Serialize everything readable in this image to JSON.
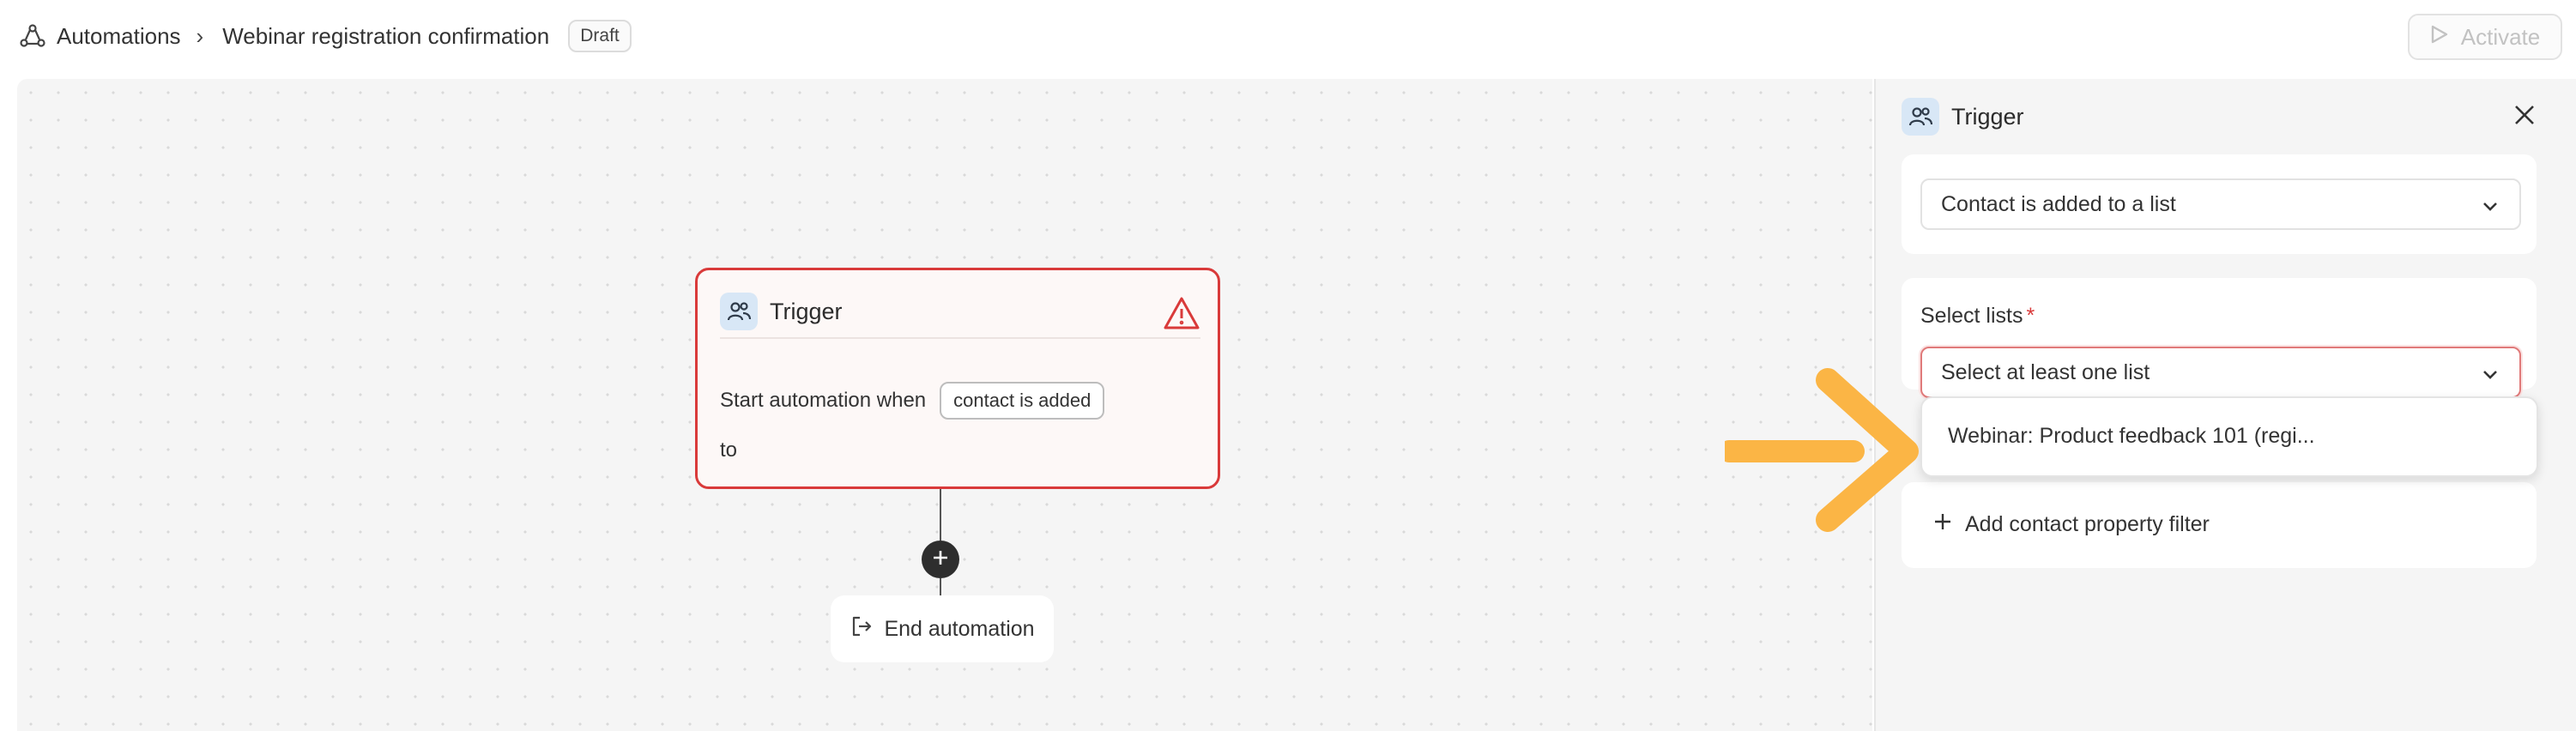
{
  "breadcrumb": {
    "root": "Automations",
    "separator": "›",
    "current": "Webinar registration confirmation",
    "status_badge": "Draft"
  },
  "toolbar": {
    "activate_label": "Activate"
  },
  "canvas": {
    "trigger_node": {
      "title": "Trigger",
      "line1_prefix": "Start automation when",
      "event_chip": "contact is added",
      "line2": "to"
    },
    "end_node": {
      "label": "End automation"
    }
  },
  "panel": {
    "title": "Trigger",
    "trigger_type": {
      "value": "Contact is added to a list"
    },
    "select_lists": {
      "label": "Select lists",
      "required_mark": "*",
      "placeholder": "Select at least one list",
      "options": [
        "Webinar: Product feedback 101 (regi..."
      ]
    },
    "add_filter_label": "Add contact property filter"
  },
  "colors": {
    "error": "#d93a3a",
    "annotation_arrow": "#fbb545",
    "icon_bg": "#d8e7f6"
  },
  "icons": [
    "automation-icon",
    "people-icon",
    "warning-icon",
    "plus-icon",
    "exit-icon",
    "close-icon",
    "chevron-down-icon",
    "play-icon"
  ]
}
